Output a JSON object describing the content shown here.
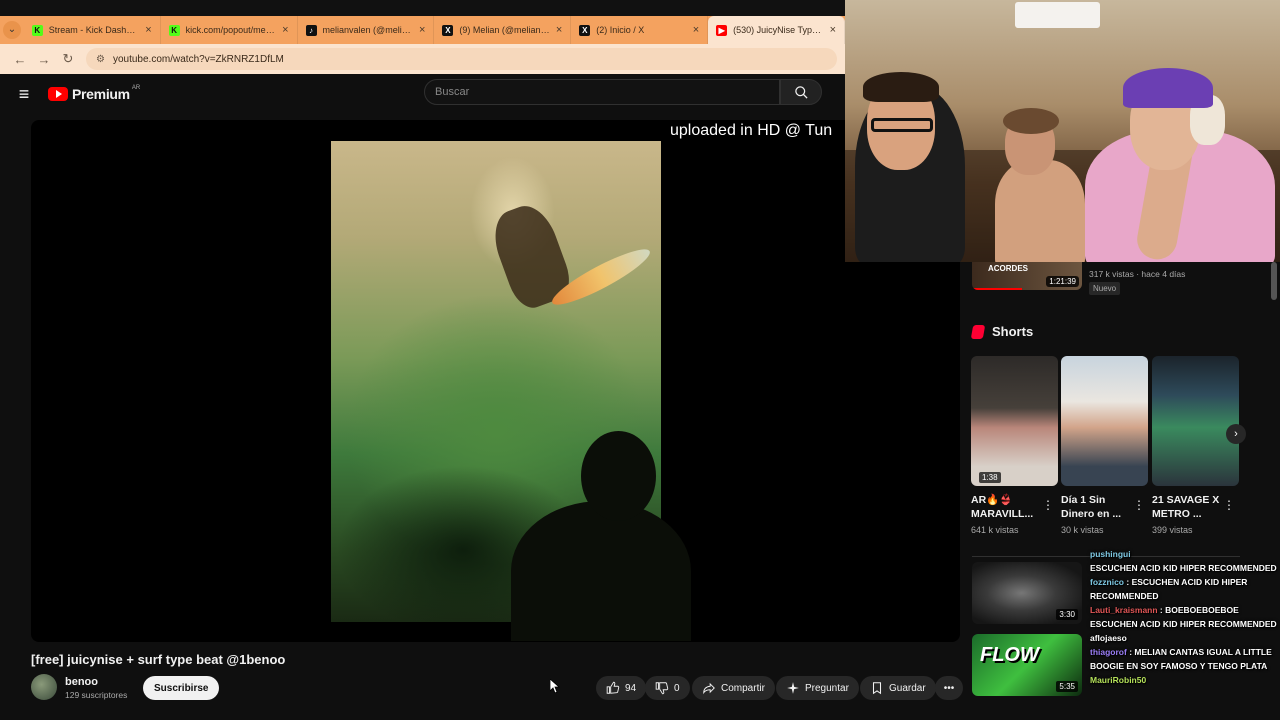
{
  "browser": {
    "tabs": [
      {
        "title": "Stream - Kick Dashboard",
        "icon": "kick-icon",
        "color": "#53fc18"
      },
      {
        "title": "kick.com/popout/melian",
        "icon": "kick-icon",
        "color": "#53fc18"
      },
      {
        "title": "melianvalen (@melianval",
        "icon": "tiktok-icon",
        "color": "#111111"
      },
      {
        "title": "(9) Melian (@melianvalen",
        "icon": "x-icon",
        "color": "#111111"
      },
      {
        "title": "(2) Inicio / X",
        "icon": "x-icon",
        "color": "#111111"
      },
      {
        "title": "(530) JuicyNise Type Beat",
        "icon": "youtube-icon",
        "color": "#ff0000"
      }
    ],
    "url": "youtube.com/watch?v=ZkRNRZ1DfLM"
  },
  "youtube": {
    "logo_text": "Premium",
    "country": "AR",
    "search_placeholder": "Buscar"
  },
  "player": {
    "overlay_text": "uploaded in HD @ Tun"
  },
  "video": {
    "title": "[free] juicynise + surf type beat @1benoo",
    "channel": "benoo",
    "subscribers": "129 suscriptores",
    "subscribe_label": "Suscribirse",
    "likes": "94",
    "dislikes": "0",
    "share_label": "Compartir",
    "ask_label": "Preguntar",
    "save_label": "Guardar"
  },
  "sidebar": {
    "rec_top": {
      "thumb_label": "ACORDES",
      "duration": "1:21:39",
      "meta": "317 k vistas · hace 4 días",
      "badge": "Nuevo"
    },
    "shorts_title": "Shorts",
    "shorts": [
      {
        "title": "AR🔥👙 MARAVILL...",
        "views": "641 k vistas",
        "duration": "1:38"
      },
      {
        "title": "Día 1 Sin Dinero en ...",
        "views": "30 k vistas"
      },
      {
        "title": "21 SAVAGE X METRO ...",
        "views": "399 vistas"
      }
    ],
    "videos": [
      {
        "duration": "3:30"
      },
      {
        "duration": "5:35",
        "thumb_text": "FLOW"
      }
    ]
  },
  "chat": [
    {
      "user": "pushingui",
      "text": "",
      "color": "#7ec8e3"
    },
    {
      "user": "",
      "text": "ESCUCHEN ACID KID HIPER RECOMMENDED",
      "color": "#f1f1f1"
    },
    {
      "user": "fozznico",
      "text": "ESCUCHEN ACID KID HIPER RECOMMENDED",
      "color": "#7ec8e3"
    },
    {
      "user": "Lauti_kraismann",
      "text": "BOEBOEBOEBOE",
      "color": "#e05656"
    },
    {
      "user": "",
      "text": "ESCUCHEN ACID KID HIPER RECOMMENDED",
      "color": "#f1f1f1"
    },
    {
      "user": "",
      "text": "aflojaeso",
      "color": "#6ab0f3"
    },
    {
      "user": "thiagorof",
      "text": "MELIAN CANTAS IGUAL A LITTLE BOOGIE EN SOY FAMOSO Y TENGO PLATA",
      "color": "#9b7ef7"
    },
    {
      "user": "MauriRobin50",
      "text": "",
      "color": "#b4e05a"
    }
  ]
}
